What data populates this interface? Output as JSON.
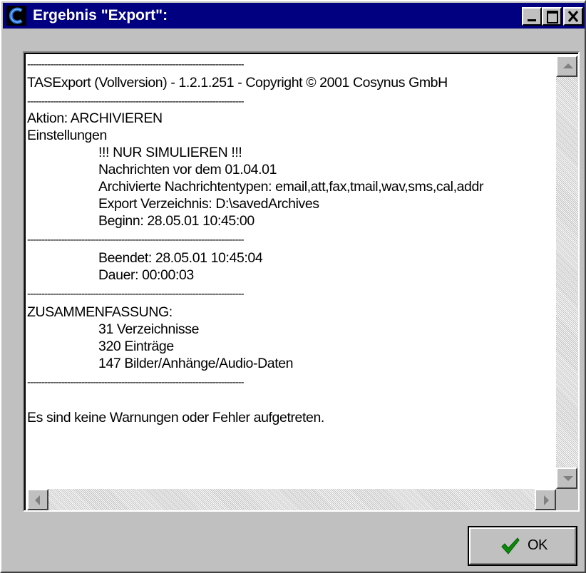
{
  "window": {
    "title": "Ergebnis \"Export\":"
  },
  "log": {
    "separator": "----------------------------------------------------------------------------",
    "lines": {
      "header": "TASExport (Vollversion) - 1.2.1.251 - Copyright © 2001 Cosynus GmbH",
      "action": "Aktion: ARCHIVIEREN",
      "settings": "Einstellungen",
      "simulate": "!!! NUR SIMULIEREN !!!",
      "before_date": "Nachrichten vor dem 01.04.01",
      "types": "Archivierte Nachrichtentypen: email,att,fax,tmail,wav,sms,cal,addr",
      "export_dir": "Export Verzeichnis: D:\\savedArchives",
      "begin": "Beginn: 28.05.01 10:45:00",
      "end": "Beendet: 28.05.01 10:45:04",
      "duration": "Dauer: 00:00:03",
      "summary": "ZUSAMMENFASSUNG:",
      "dirs": "31 Verzeichnisse",
      "entries": "320 Einträge",
      "attachments": "147 Bilder/Anhänge/Audio-Daten",
      "result": "Es sind keine Warnungen oder Fehler aufgetreten."
    }
  },
  "buttons": {
    "ok_label": "OK"
  },
  "icons": {
    "app": "app-logo-icon",
    "minimize": "minimize-icon",
    "maximize": "maximize-icon",
    "close": "close-icon",
    "ok": "checkmark-icon"
  },
  "colors": {
    "titlebar": "#000080",
    "face": "#c0c0c0",
    "check": "#0a8a0a"
  }
}
